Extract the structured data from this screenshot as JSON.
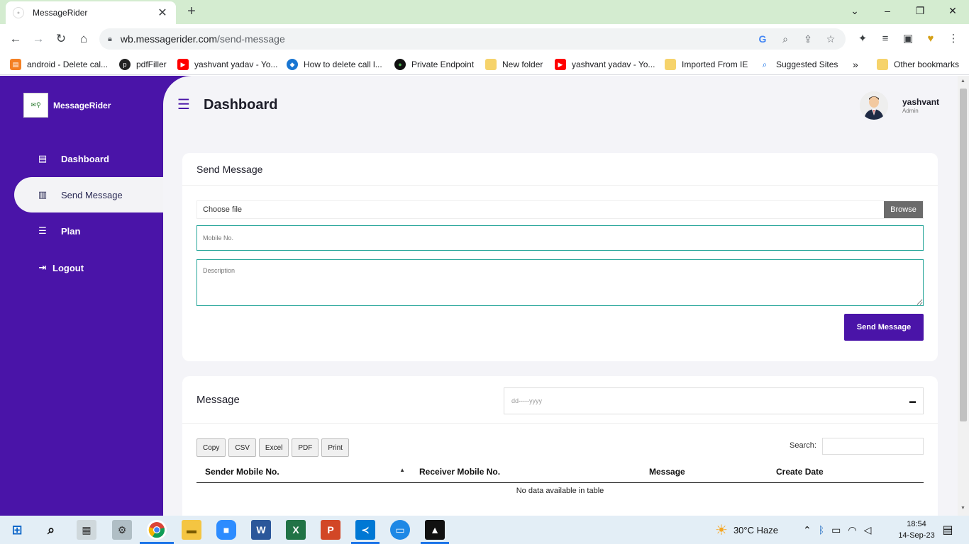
{
  "browser": {
    "tab_title": "MessageRider",
    "url_host": "wb.messagerider.com",
    "url_path": "/send-message",
    "bookmarks": [
      {
        "label": "android - Delete cal...",
        "icon": "stack-icon"
      },
      {
        "label": "pdfFiller",
        "icon": "pdffiller-icon"
      },
      {
        "label": "yashvant yadav - Yo...",
        "icon": "youtube-icon"
      },
      {
        "label": "How to delete call l...",
        "icon": "compass-icon"
      },
      {
        "label": "Private Endpoint",
        "icon": "leaf-icon"
      },
      {
        "label": "New folder",
        "icon": "folder-icon"
      },
      {
        "label": "yashvant yadav - Yo...",
        "icon": "youtube-icon"
      },
      {
        "label": "Imported From IE",
        "icon": "folder-icon"
      },
      {
        "label": "Suggested Sites",
        "icon": "search-icon"
      },
      {
        "label": "Other bookmarks",
        "icon": "folder-icon"
      }
    ]
  },
  "sidebar": {
    "brand": "MessageRider",
    "items": [
      {
        "label": "Dashboard",
        "icon": "dashboard-icon"
      },
      {
        "label": "Send Message",
        "icon": "message-icon"
      },
      {
        "label": "Plan",
        "icon": "sliders-icon"
      },
      {
        "label": "Logout",
        "icon": "logout-icon"
      }
    ]
  },
  "header": {
    "title": "Dashboard",
    "user_name": "yashvant",
    "user_role": "Admin"
  },
  "send_form": {
    "title": "Send Message",
    "file_label": "Choose file",
    "browse_label": "Browse",
    "mobile_placeholder": "Mobile No.",
    "description_placeholder": "Description",
    "submit_label": "Send Message"
  },
  "messages": {
    "title": "Message",
    "date_placeholder": "dd-----yyyy",
    "export_buttons": [
      "Copy",
      "CSV",
      "Excel",
      "PDF",
      "Print"
    ],
    "search_label": "Search:",
    "columns": [
      "Sender Mobile No.",
      "Receiver Mobile No.",
      "Message",
      "Create Date"
    ],
    "empty_text": "No data available in table"
  },
  "taskbar": {
    "weather": "30°C  Haze",
    "time": "18:54",
    "date": "14-Sep-23"
  },
  "colors": {
    "brand_purple": "#4a14a8",
    "field_border": "#26a69a",
    "tab_strip": "#d4ecd0"
  }
}
